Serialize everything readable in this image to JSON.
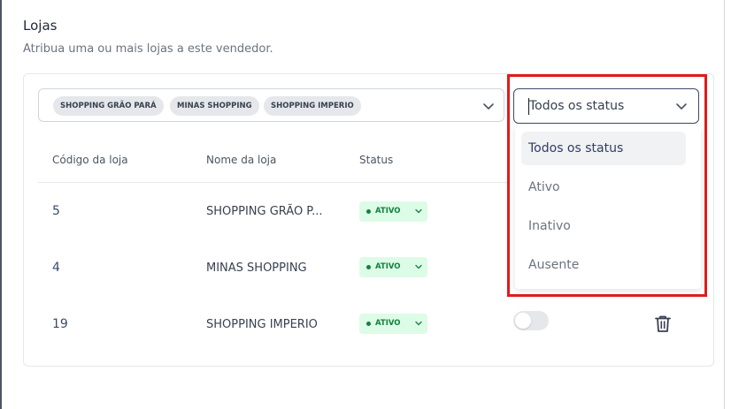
{
  "section": {
    "title": "Lojas",
    "subtitle": "Atribua uma ou mais lojas a este vendedor."
  },
  "stores_select": {
    "chips": [
      "SHOPPING GRÃO PARÁ",
      "MINAS SHOPPING",
      "SHOPPING IMPERIO"
    ],
    "icon": "chevron-down-icon"
  },
  "status_filter": {
    "value": "Todos os status",
    "icon": "chevron-down-icon",
    "options": [
      "Todos os status",
      "Ativo",
      "Inativo",
      "Ausente"
    ],
    "selected_index": 0
  },
  "table": {
    "headers": [
      "Código da loja",
      "Nome da loja",
      "Status"
    ],
    "rows": [
      {
        "code": "5",
        "name": "SHOPPING GRÃO P...",
        "status": "ATIVO"
      },
      {
        "code": "4",
        "name": "MINAS SHOPPING",
        "status": "ATIVO"
      },
      {
        "code": "19",
        "name": "SHOPPING IMPERIO",
        "status": "ATIVO"
      }
    ]
  },
  "row_actions": {
    "toggle_on": false,
    "delete_icon": "trash-icon"
  },
  "colors": {
    "highlight": "#e01b1b",
    "status_bg": "#dcfce7",
    "status_text": "#15803d",
    "accent": "#3b4a6b"
  }
}
